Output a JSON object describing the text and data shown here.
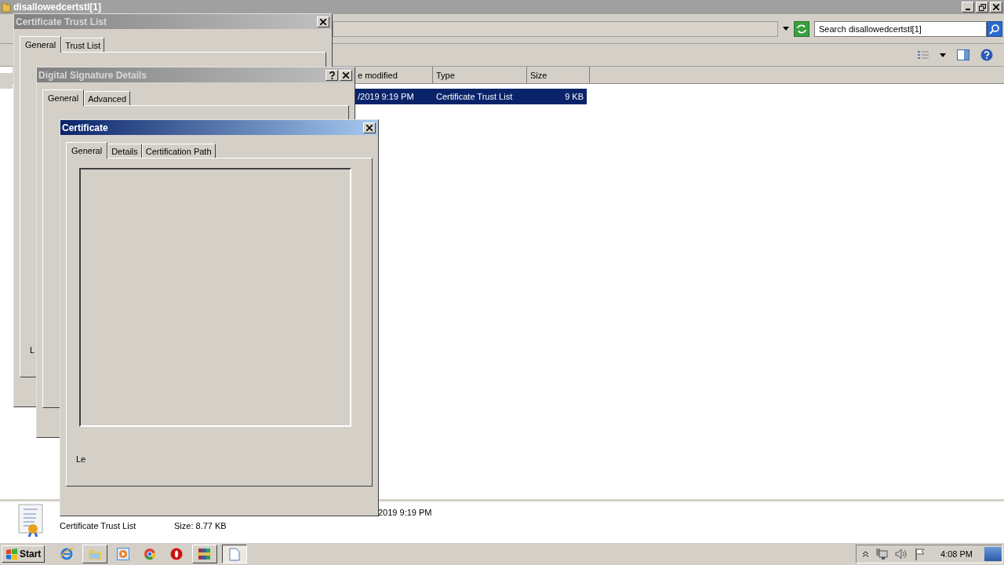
{
  "explorer": {
    "title": "disallowedcertstl[1]",
    "search": {
      "placeholder": "Search disallowedcertstl[1]"
    },
    "columns": [
      "e modified",
      "Type",
      "Size"
    ],
    "rows": [
      {
        "cells": [
          "/2019 9:19 PM",
          "Certificate Trust List",
          "9 KB"
        ],
        "selected": true
      }
    ],
    "details": {
      "name": "Certificate Trust List",
      "size": "Size: 8.77 KB",
      "created": "2019 9:19 PM"
    }
  },
  "dialogs": [
    {
      "title": "Certificate Trust List",
      "active": false,
      "help": false,
      "tabs": [
        {
          "label": "General",
          "selected": true
        },
        {
          "label": "Trust List",
          "selected": false
        }
      ],
      "text": "L"
    },
    {
      "title": "Digital Signature Details",
      "active": false,
      "help": true,
      "tabs": [
        {
          "label": "General",
          "selected": true
        },
        {
          "label": "Advanced",
          "selected": false
        }
      ]
    },
    {
      "title": "Certificate",
      "active": true,
      "help": false,
      "tabs": [
        {
          "label": "General",
          "selected": true
        },
        {
          "label": "Details",
          "selected": false
        },
        {
          "label": "Certification Path",
          "selected": false
        }
      ],
      "text": "Le"
    }
  ],
  "taskbar": {
    "start": "Start",
    "apps": [
      {
        "kind": "ie",
        "running": false,
        "selected": false
      },
      {
        "kind": "folder",
        "running": true,
        "selected": false
      },
      {
        "kind": "media",
        "running": false,
        "selected": false
      },
      {
        "kind": "chrome",
        "running": false,
        "selected": false
      },
      {
        "kind": "opera",
        "running": false,
        "selected": false
      },
      {
        "kind": "archive",
        "running": true,
        "selected": false
      },
      {
        "kind": "document",
        "running": true,
        "selected": true
      }
    ],
    "clock": "4:08 PM"
  }
}
